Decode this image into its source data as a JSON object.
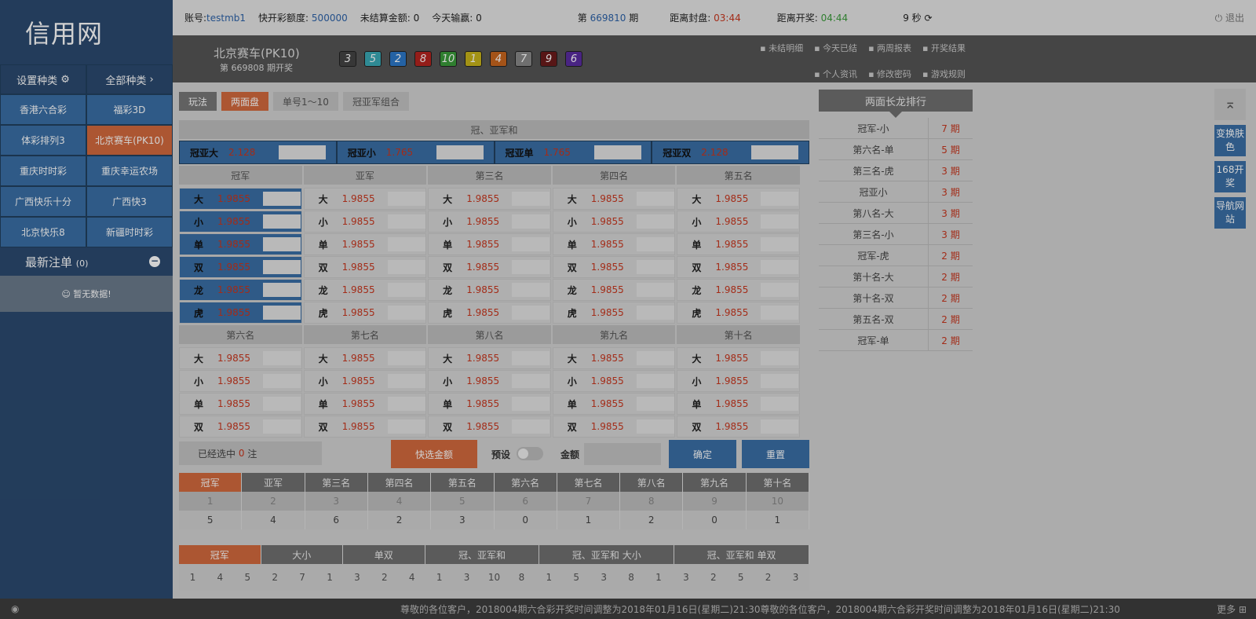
{
  "logo": "信用网",
  "sidebar": {
    "set_label": "设置种类",
    "all_label": "全部种类",
    "games": [
      "香港六合彩",
      "福彩3D",
      "体彩排列3",
      "北京赛车(PK10)",
      "重庆时时彩",
      "重庆幸运农场",
      "广西快乐十分",
      "广西快3",
      "北京快乐8",
      "新疆时时彩"
    ],
    "recent_label": "最新注单",
    "recent_count": "(0)",
    "no_data": "☺ 暂无数据!"
  },
  "topbar": {
    "account_label": "账号:",
    "account": "testmb1",
    "quota_label": "快开彩额度:",
    "quota": "500000",
    "unsettled_label": "未结算金额:",
    "unsettled": "0",
    "today_label": "今天输赢:",
    "today": "0",
    "issue_pre": "第",
    "issue": "669810",
    "issue_post": "期",
    "close_label": "距离封盘:",
    "close": "03:44",
    "open_label": "距离开奖:",
    "open": "04:44",
    "refresh": "9 秒",
    "logout": "退出"
  },
  "lottery": {
    "name": "北京赛车(PK10)",
    "issue_text": "第 669808 期开奖",
    "balls": [
      "3",
      "5",
      "2",
      "8",
      "10",
      "1",
      "4",
      "7",
      "9",
      "6"
    ],
    "ball_colors": [
      "#444",
      "#3aa9b5",
      "#2d78c9",
      "#b5241f",
      "#3a9a3a",
      "#c7b21a",
      "#c9661e",
      "#888",
      "#6b1b1b",
      "#5a2ca0"
    ]
  },
  "links1": [
    "未结明细",
    "今天已结",
    "两周报表",
    "开奖结果"
  ],
  "links2": [
    "个人资讯",
    "修改密码",
    "游戏规则"
  ],
  "play": {
    "label": "玩法",
    "tabs": [
      "两面盘",
      "单号1～10",
      "冠亚军组合"
    ]
  },
  "combo": {
    "title": "冠、亚军和",
    "items": [
      {
        "name": "冠亚大",
        "odds": "2.128"
      },
      {
        "name": "冠亚小",
        "odds": "1.765"
      },
      {
        "name": "冠亚单",
        "odds": "1.765"
      },
      {
        "name": "冠亚双",
        "odds": "2.128"
      }
    ]
  },
  "rank_titles_top": [
    "冠军",
    "亚军",
    "第三名",
    "第四名",
    "第五名"
  ],
  "rank_titles_bottom": [
    "第六名",
    "第七名",
    "第八名",
    "第九名",
    "第十名"
  ],
  "bet_keys_top": [
    "大",
    "小",
    "单",
    "双",
    "龙",
    "虎"
  ],
  "bet_keys_bottom": [
    "大",
    "小",
    "单",
    "双"
  ],
  "odds": "1.9855",
  "bottom": {
    "selected_pre": "已经选中",
    "selected_count": "0",
    "selected_post": "注",
    "quick": "快选金额",
    "preset": "预设",
    "amount": "金额",
    "confirm": "确定",
    "reset": "重置"
  },
  "stat1": {
    "headers": [
      "冠军",
      "亚军",
      "第三名",
      "第四名",
      "第五名",
      "第六名",
      "第七名",
      "第八名",
      "第九名",
      "第十名"
    ],
    "row1": [
      "1",
      "2",
      "3",
      "4",
      "5",
      "6",
      "7",
      "8",
      "9",
      "10"
    ],
    "row2": [
      "5",
      "4",
      "6",
      "2",
      "3",
      "0",
      "1",
      "2",
      "0",
      "1"
    ]
  },
  "stat2": {
    "headers": [
      "冠军",
      "大小",
      "单双",
      "冠、亚军和",
      "冠、亚军和 大小",
      "冠、亚军和 单双"
    ],
    "values": [
      "1",
      "4",
      "5",
      "2",
      "7",
      "1",
      "3",
      "2",
      "4",
      "1",
      "3",
      "10",
      "8",
      "1",
      "5",
      "3",
      "8",
      "1",
      "3",
      "2",
      "5",
      "2",
      "3"
    ]
  },
  "longdragon": {
    "title": "两面长龙排行",
    "rows": [
      {
        "n": "冠军-小",
        "p": "7 期"
      },
      {
        "n": "第六名-单",
        "p": "5 期"
      },
      {
        "n": "第三名-虎",
        "p": "3 期"
      },
      {
        "n": "冠亚小",
        "p": "3 期"
      },
      {
        "n": "第八名-大",
        "p": "3 期"
      },
      {
        "n": "第三名-小",
        "p": "3 期"
      },
      {
        "n": "冠军-虎",
        "p": "2 期"
      },
      {
        "n": "第十名-大",
        "p": "2 期"
      },
      {
        "n": "第十名-双",
        "p": "2 期"
      },
      {
        "n": "第五名-双",
        "p": "2 期"
      },
      {
        "n": "冠军-单",
        "p": "2 期"
      }
    ]
  },
  "rtools": [
    "变换肤色",
    "168开奖",
    "导航网站"
  ],
  "footer": {
    "marquee": "尊敬的各位客户，2018004期六合彩开奖时间调整为2018年01月16日(星期二)21:30尊敬的各位客户，2018004期六合彩开奖时间调整为2018年01月16日(星期二)21:30",
    "more": "更多"
  }
}
